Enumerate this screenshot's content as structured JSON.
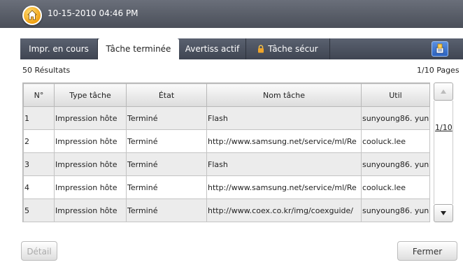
{
  "header": {
    "datetime": "10-15-2010 04:46 PM"
  },
  "tabs": [
    {
      "label": "Impr. en cours"
    },
    {
      "label": "Tâche terminée"
    },
    {
      "label": "Avertiss actif"
    },
    {
      "label": "Tâche sécur"
    }
  ],
  "results": {
    "count": "50 Résultats",
    "pages": "1/10 Pages"
  },
  "table": {
    "headers": [
      "N°",
      "Type tâche",
      "État",
      "Nom tâche",
      "Util"
    ],
    "rows": [
      [
        "1",
        "Impression hôte",
        "Terminé",
        "Flash",
        "sunyoung86. yun"
      ],
      [
        "2",
        "Impression hôte",
        "Terminé",
        "http://www.samsung.net/service/ml/Re",
        "cooluck.lee"
      ],
      [
        "3",
        "Impression hôte",
        "Terminé",
        "Flash",
        "sunyoung86. yun"
      ],
      [
        "4",
        "Impression hôte",
        "Terminé",
        "http://www.samsung.net/service/ml/Re",
        "cooluck.lee"
      ],
      [
        "5",
        "Impression hôte",
        "Terminé",
        "http://www.coex.co.kr/img/coexguide/",
        "sunyoung86. yun"
      ]
    ]
  },
  "scroll": {
    "page_indicator": "1/10"
  },
  "buttons": {
    "detail": "Détail",
    "close": "Fermer"
  }
}
